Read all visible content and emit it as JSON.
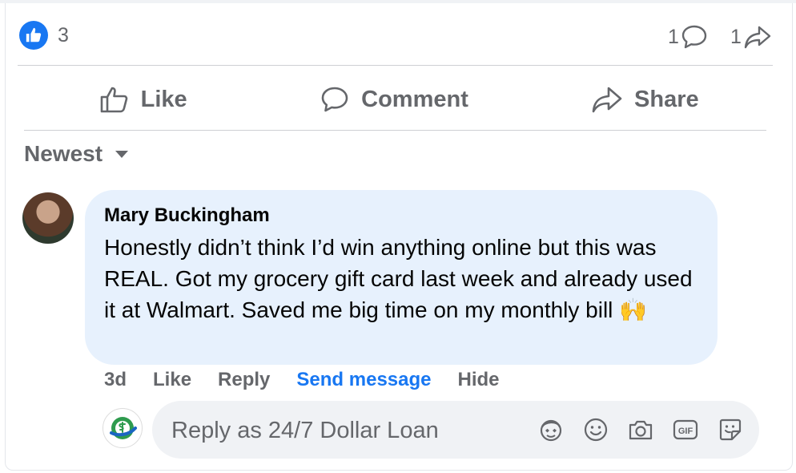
{
  "stats": {
    "likes": "3",
    "comments_count": "1",
    "shares_count": "1"
  },
  "actions": {
    "like": "Like",
    "comment": "Comment",
    "share": "Share"
  },
  "sort": {
    "label": "Newest"
  },
  "comment": {
    "author": "Mary Buckingham",
    "text": "Honestly didn’t think I’d win anything online but this was REAL. Got my grocery gift card last week and already used it at Walmart. Saved me big time on my monthly bill 🙌",
    "time": "3d",
    "like": "Like",
    "reply": "Reply",
    "send_message": "Send message",
    "hide": "Hide"
  },
  "reply": {
    "placeholder": "Reply as 24/7 Dollar Loan"
  },
  "colors": {
    "accent": "#1877f2",
    "bubble": "#e7f1fd",
    "muted": "#65676b"
  }
}
